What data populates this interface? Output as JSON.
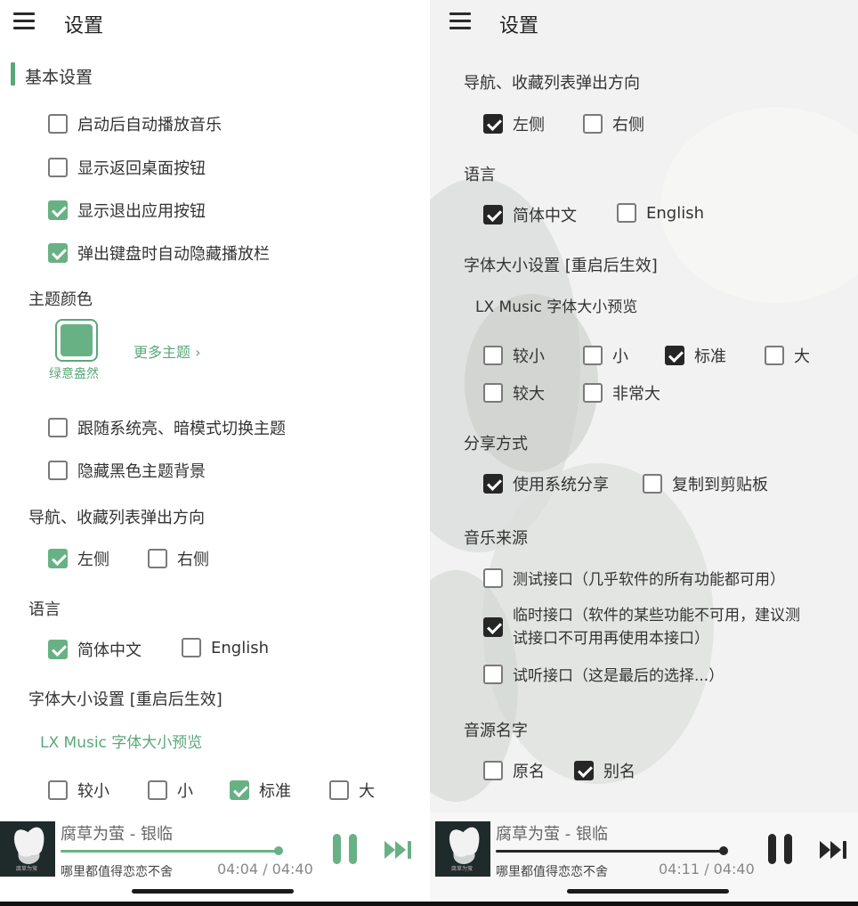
{
  "left": {
    "header": {
      "title": "设置"
    },
    "basic": {
      "title": "基本设置",
      "items": [
        {
          "label": "启动后自动播放音乐",
          "checked": false
        },
        {
          "label": "显示返回桌面按钮",
          "checked": false
        },
        {
          "label": "显示退出应用按钮",
          "checked": true
        },
        {
          "label": "弹出键盘时自动隐藏播放栏",
          "checked": true
        }
      ]
    },
    "theme": {
      "title": "主题颜色",
      "swatch_name": "绿意盎然",
      "more_label": "更多主题 ›",
      "items": [
        {
          "label": "跟随系统亮、暗模式切换主题",
          "checked": false
        },
        {
          "label": "隐藏黑色主题背景",
          "checked": false
        }
      ]
    },
    "nav": {
      "title": "导航、收藏列表弹出方向",
      "options": [
        {
          "label": "左侧",
          "checked": true
        },
        {
          "label": "右侧",
          "checked": false
        }
      ]
    },
    "lang": {
      "title": "语言",
      "options": [
        {
          "label": "简体中文",
          "checked": true
        },
        {
          "label": "English",
          "checked": false
        }
      ]
    },
    "font": {
      "title": "字体大小设置 [重启后生效]",
      "preview": "LX Music 字体大小预览",
      "options": [
        {
          "label": "较小",
          "checked": false
        },
        {
          "label": "小",
          "checked": false
        },
        {
          "label": "标准",
          "checked": true
        },
        {
          "label": "大",
          "checked": false
        }
      ]
    },
    "player": {
      "song": "腐草为萤 - 银临",
      "lyric": "哪里都值得恋恋不舍",
      "time": "04:04 / 04:40",
      "progress": 0.98,
      "album_caption": "腐草为萤"
    }
  },
  "right": {
    "header": {
      "title": "设置"
    },
    "nav": {
      "title": "导航、收藏列表弹出方向",
      "options": [
        {
          "label": "左侧",
          "checked": true
        },
        {
          "label": "右侧",
          "checked": false
        }
      ]
    },
    "lang": {
      "title": "语言",
      "options": [
        {
          "label": "简体中文",
          "checked": true
        },
        {
          "label": "English",
          "checked": false
        }
      ]
    },
    "font": {
      "title": "字体大小设置 [重启后生效]",
      "preview": "LX Music 字体大小预览",
      "options": [
        {
          "label": "较小",
          "checked": false
        },
        {
          "label": "小",
          "checked": false
        },
        {
          "label": "标准",
          "checked": true
        },
        {
          "label": "大",
          "checked": false
        },
        {
          "label": "较大",
          "checked": false
        },
        {
          "label": "非常大",
          "checked": false
        }
      ]
    },
    "share": {
      "title": "分享方式",
      "options": [
        {
          "label": "使用系统分享",
          "checked": true
        },
        {
          "label": "复制到剪贴板",
          "checked": false
        }
      ]
    },
    "source": {
      "title": "音乐来源",
      "options": [
        {
          "label": "测试接口（几乎软件的所有功能都可用）",
          "checked": false
        },
        {
          "label_line1": "临时接口（软件的某些功能不可用，建议测",
          "label_line2": "试接口不可用再使用本接口）",
          "checked": true
        },
        {
          "label": "试听接口（这是最后的选择...）",
          "checked": false
        }
      ]
    },
    "source_name": {
      "title": "音源名字",
      "options": [
        {
          "label": "原名",
          "checked": false
        },
        {
          "label": "别名",
          "checked": true
        }
      ]
    },
    "player": {
      "song": "腐草为萤 - 银临",
      "lyric": "哪里都值得恋恋不舍",
      "time": "04:11 / 04:40",
      "progress": 1.0,
      "album_caption": "腐草为萤"
    }
  },
  "colors": {
    "accent": "#68b185",
    "accent_text": "#5aa87a",
    "check_dark": "#262626",
    "right_bg": "#f1f2f1"
  },
  "icons": {
    "menu": "hamburger-icon",
    "pause": "pause-icon",
    "next": "skip-next-icon",
    "chevron": "chevron-right-icon"
  }
}
